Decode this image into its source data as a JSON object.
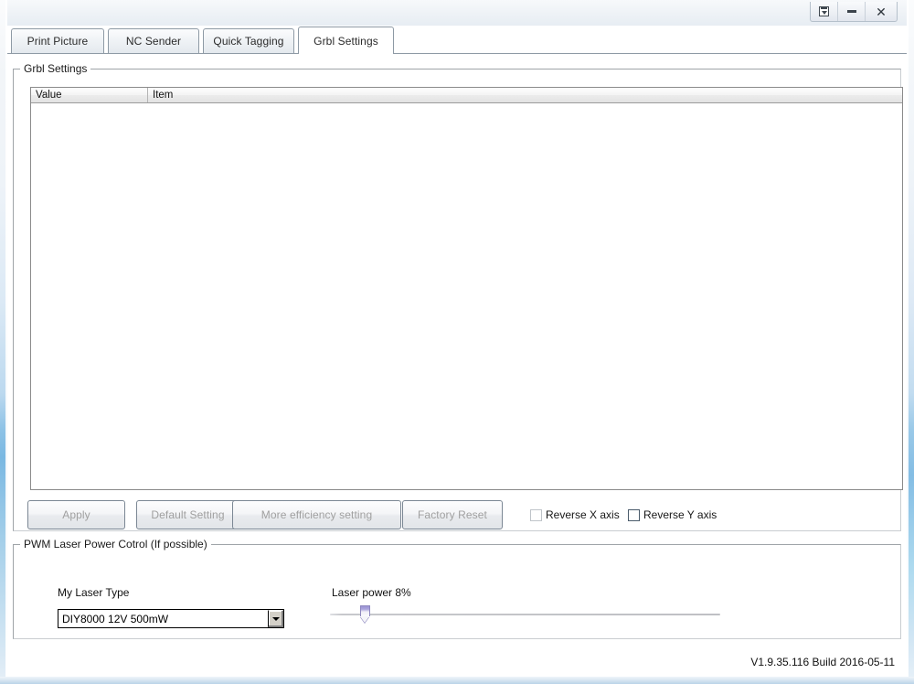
{
  "window": {
    "title": "",
    "controls": [
      {
        "name": "restore-dropdown-button",
        "icon": "restore-icon",
        "label": ""
      },
      {
        "name": "minimize-button",
        "icon": "minimize-icon",
        "label": ""
      },
      {
        "name": "close-button",
        "icon": "close-icon",
        "label": "✕"
      }
    ]
  },
  "tabs": [
    {
      "label": "Print Picture",
      "active": false
    },
    {
      "label": "NC Sender",
      "active": false
    },
    {
      "label": "Quick Tagging",
      "active": false
    },
    {
      "label": "Grbl Settings",
      "active": true
    }
  ],
  "grbl_settings_group": {
    "title": "Grbl Settings",
    "list": {
      "columns": [
        "Value",
        "Item"
      ],
      "rows": []
    },
    "buttons": [
      {
        "label": "Apply",
        "enabled": false
      },
      {
        "label": "Default Setting",
        "enabled": false
      },
      {
        "label": "More efficiency setting",
        "enabled": false
      },
      {
        "label": "Factory Reset",
        "enabled": false
      }
    ],
    "checkboxes": [
      {
        "label": "Reverse X axis",
        "checked": false,
        "enabled": false
      },
      {
        "label": "Reverse Y axis",
        "checked": false,
        "enabled": true
      }
    ]
  },
  "pwm_group": {
    "title": "PWM Laser Power Cotrol (If possible)",
    "laser_type_label": "My Laser Type",
    "laser_type_value": "DIY8000 12V 500mW",
    "laser_power_label": "Laser power 8%",
    "laser_power_percent": 8
  },
  "status": {
    "version": "V1.9.35.116 Build 2016-05-11"
  }
}
